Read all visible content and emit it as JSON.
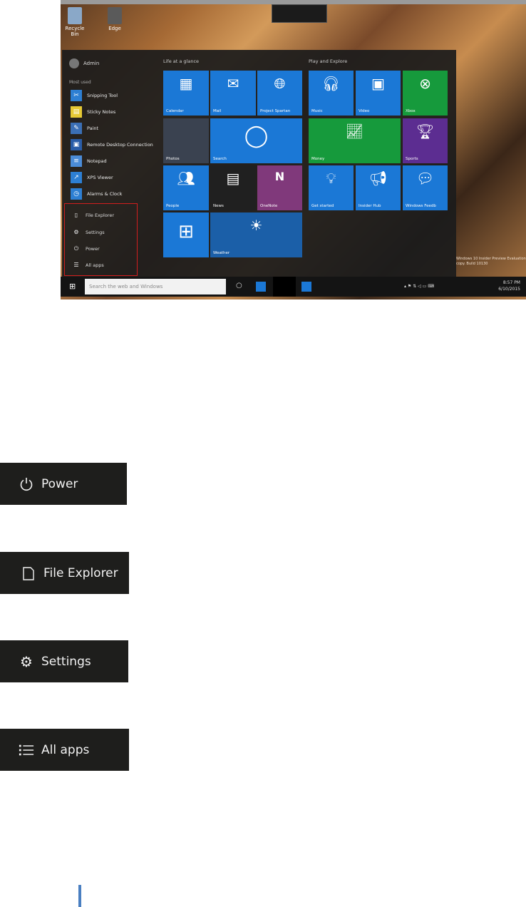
{
  "desktop": {
    "icons": [
      {
        "label": "Recycle Bin"
      },
      {
        "label": "Edge"
      }
    ],
    "watermark": "Windows 10 Insider Preview Evaluation copy. Build 10130"
  },
  "start_menu": {
    "user": "Admin",
    "most_used_label": "Most used",
    "apps": [
      {
        "label": "Snipping Tool",
        "icon": "scissors-icon"
      },
      {
        "label": "Sticky Notes",
        "icon": "note-icon"
      },
      {
        "label": "Paint",
        "icon": "palette-icon"
      },
      {
        "label": "Remote Desktop Connection",
        "icon": "remote-desktop-icon"
      },
      {
        "label": "Notepad",
        "icon": "notepad-icon"
      },
      {
        "label": "XPS Viewer",
        "icon": "xps-icon"
      },
      {
        "label": "Alarms & Clock",
        "icon": "clock-icon"
      }
    ],
    "system_items": [
      {
        "label": "File Explorer",
        "icon": "file-explorer-icon"
      },
      {
        "label": "Settings",
        "icon": "gear-icon"
      },
      {
        "label": "Power",
        "icon": "power-icon"
      },
      {
        "label": "All apps",
        "icon": "list-icon"
      }
    ],
    "group1_title": "Life at a glance",
    "group2_title": "Play and Explore",
    "tiles": {
      "calendar": "Calendar",
      "mail": "Mail",
      "project_spartan": "Project Spartan",
      "photos": "Photos",
      "search": "Search",
      "people": "People",
      "news": "News",
      "onenote": "OneNote",
      "store": "",
      "weather": "Weather",
      "music": "Music",
      "video": "Video",
      "xbox": "Xbox",
      "money": "Money",
      "sports": "Sports",
      "get_started": "Get started",
      "insider_hub": "Insider Hub",
      "windows_feedback": "Windows Feedb"
    },
    "colors": {
      "accent": "#1b78d6",
      "green": "#169a3c",
      "purple": "#5c2d91",
      "onenote": "#80397b"
    }
  },
  "taskbar": {
    "search_placeholder": "Search the web and Windows",
    "time": "8:57 PM",
    "date": "6/10/2015"
  },
  "callouts": [
    {
      "label": "Power",
      "icon": "power-icon"
    },
    {
      "label": "File Explorer",
      "icon": "file-explorer-icon"
    },
    {
      "label": "Settings",
      "icon": "gear-icon"
    },
    {
      "label": "All apps",
      "icon": "list-icon"
    }
  ]
}
